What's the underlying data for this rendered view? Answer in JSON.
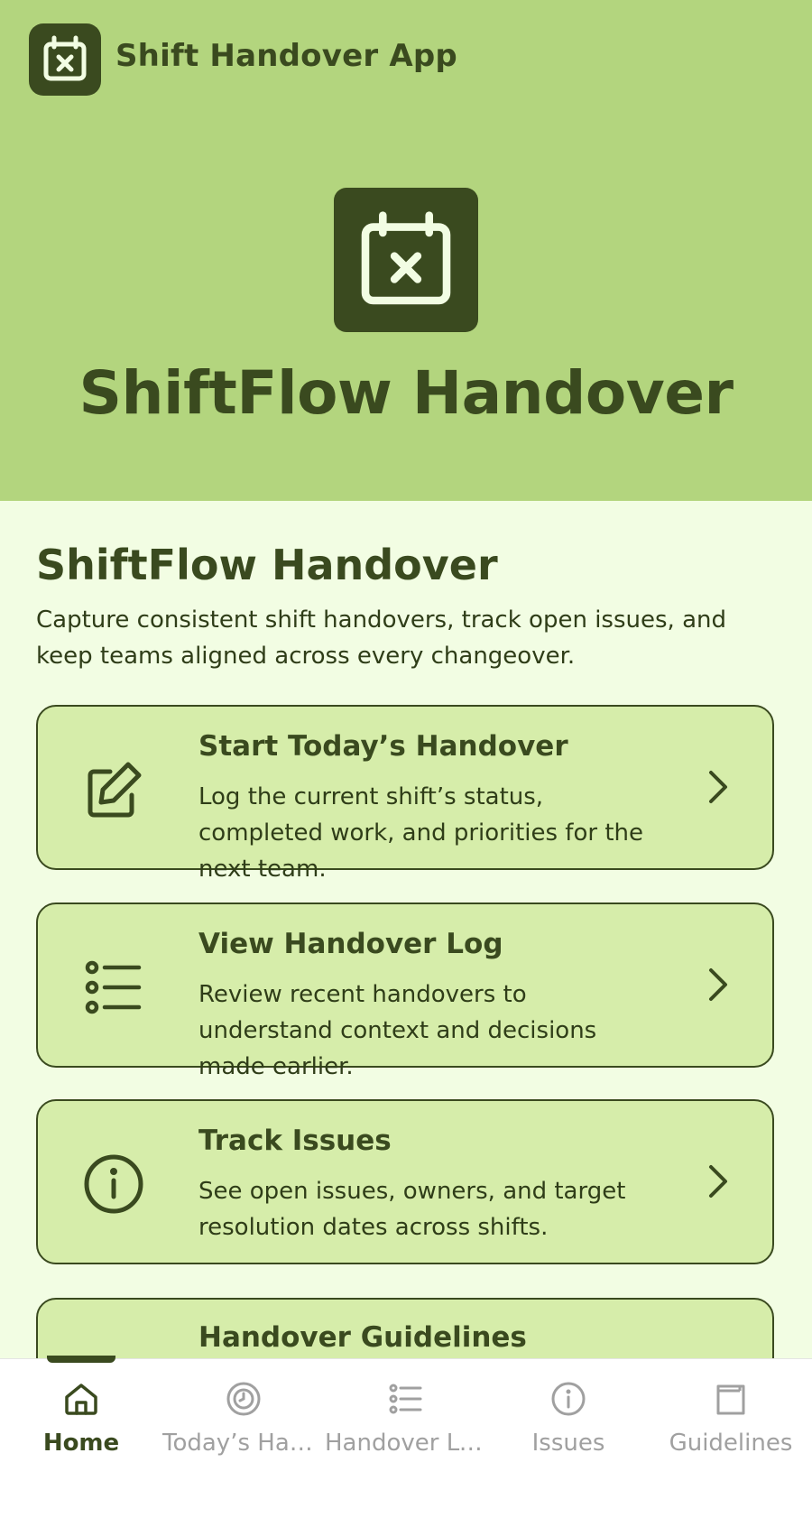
{
  "header": {
    "app_title": "Shift Handover App",
    "app_icon": "calendar-x-icon"
  },
  "hero": {
    "title": "ShiftFlow Handover",
    "icon": "calendar-x-icon"
  },
  "main": {
    "title": "ShiftFlow Handover",
    "description": "Capture consistent shift handovers, track open issues, and keep teams aligned across every changeover.",
    "cards": [
      {
        "title": "Start Today’s Handover",
        "description": "Log the current shift’s status, completed work, and priorities for the next team.",
        "icon": "edit-icon"
      },
      {
        "title": "View Handover Log",
        "description": "Review recent handovers to understand context and decisions made earlier.",
        "icon": "list-icon"
      },
      {
        "title": "Track Issues",
        "description": "See open issues, owners, and target resolution dates across shifts.",
        "icon": "info-icon"
      },
      {
        "title": "Handover Guidelines",
        "description": "",
        "icon": "book-icon"
      }
    ]
  },
  "nav": {
    "items": [
      {
        "label": "Home",
        "icon": "home-icon",
        "active": true
      },
      {
        "label": "Today’s Han…",
        "icon": "clock-icon",
        "active": false
      },
      {
        "label": "Handover Log",
        "icon": "list-icon",
        "active": false
      },
      {
        "label": "Issues",
        "icon": "info-icon",
        "active": false
      },
      {
        "label": "Guidelines",
        "icon": "book-icon",
        "active": false
      }
    ]
  },
  "colors": {
    "brand_dark": "#3a4a1f",
    "header_bg": "#b3d57e",
    "page_bg": "#f2fde3",
    "card_bg": "#d6edaa",
    "nav_inactive": "#a0a0a0"
  }
}
